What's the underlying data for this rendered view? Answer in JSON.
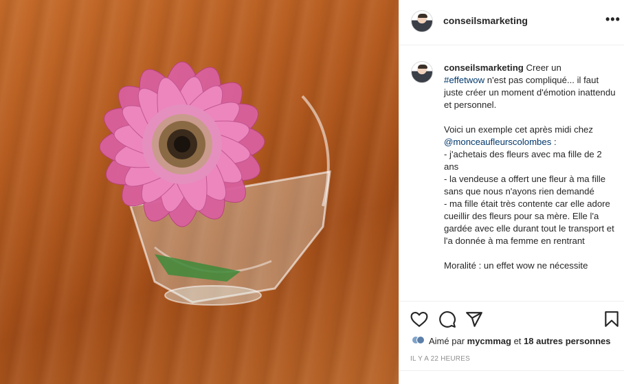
{
  "header": {
    "username": "conseilsmarketing",
    "more_glyph": "•••"
  },
  "caption": {
    "username": "conseilsmarketing",
    "text_1": " Creer un\n",
    "hashtag": "#effetwow",
    "text_2": " n'est pas compliqué... il faut juste créer un moment d'émotion inattendu et personnel.\n\nVoici un exemple cet après midi chez\n",
    "mention": "@monceaufleurscolombes",
    "text_3": " :\n- j'achetais des fleurs avec ma fille de 2 ans\n- la vendeuse a offert une fleur à ma fille sans que nous n'ayons rien demandé\n- ma fille était très contente car elle adore cueillir des fleurs pour sa mère. Elle l'a gardée avec elle durant tout le transport et l'a donnée à ma femme en rentrant\n\nMoralité : un effet wow ne nécessite"
  },
  "likes": {
    "prefix": "Aimé par ",
    "user": "mycmmag",
    "middle": " et ",
    "others": "18 autres personnes"
  },
  "timestamp": "Il y a 22 heures",
  "icons": {
    "like": "heart-icon",
    "comment": "comment-icon",
    "share": "share-icon",
    "save": "bookmark-icon",
    "more": "more-icon"
  },
  "colors": {
    "text": "#262626",
    "link": "#00376b",
    "muted": "#8e8e8e",
    "border": "#efefef"
  }
}
